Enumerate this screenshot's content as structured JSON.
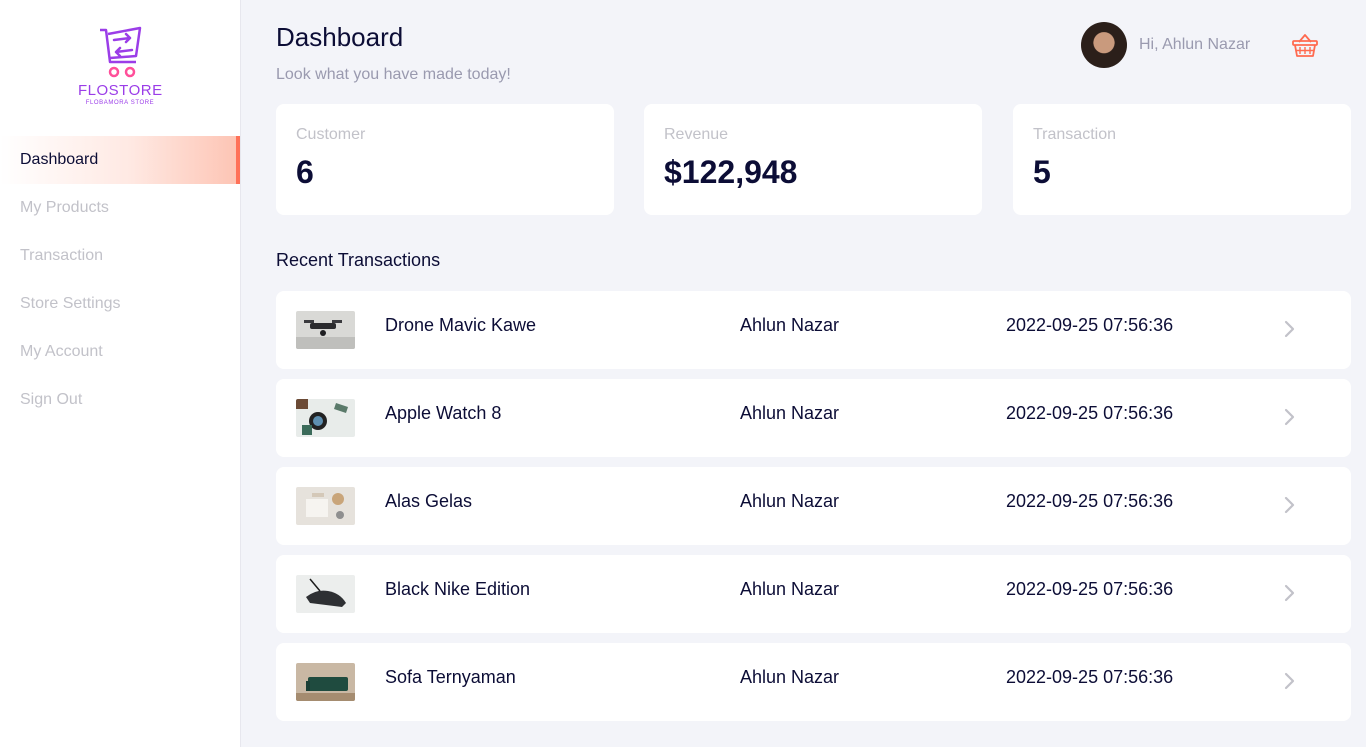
{
  "brand": {
    "name": "FLOSTORE",
    "tagline": "FLOBAMORA STORE"
  },
  "sidebar": {
    "items": [
      {
        "label": "Dashboard",
        "active": true
      },
      {
        "label": "My Products",
        "active": false
      },
      {
        "label": "Transaction",
        "active": false
      },
      {
        "label": "Store Settings",
        "active": false
      },
      {
        "label": "My Account",
        "active": false
      },
      {
        "label": "Sign Out",
        "active": false
      }
    ]
  },
  "header": {
    "title": "Dashboard",
    "subtitle": "Look what you have made today!",
    "greeting": "Hi, Ahlun Nazar",
    "cart_icon": "basket-icon"
  },
  "stats": [
    {
      "label": "Customer",
      "value": "6"
    },
    {
      "label": "Revenue",
      "value": "$122,948"
    },
    {
      "label": "Transaction",
      "value": "5"
    }
  ],
  "recent": {
    "title": "Recent Transactions",
    "rows": [
      {
        "product": "Drone Mavic Kawe",
        "customer": "Ahlun Nazar",
        "date": "2022-09-25 07:56:36"
      },
      {
        "product": "Apple Watch 8",
        "customer": "Ahlun Nazar",
        "date": "2022-09-25 07:56:36"
      },
      {
        "product": "Alas Gelas",
        "customer": "Ahlun Nazar",
        "date": "2022-09-25 07:56:36"
      },
      {
        "product": "Black Nike Edition",
        "customer": "Ahlun Nazar",
        "date": "2022-09-25 07:56:36"
      },
      {
        "product": "Sofa Ternyaman",
        "customer": "Ahlun Nazar",
        "date": "2022-09-25 07:56:36"
      }
    ]
  },
  "colors": {
    "accent": "#ff7158",
    "brand": "#9b3de8",
    "text": "#0c0d36",
    "muted": "#c2c2c9"
  }
}
